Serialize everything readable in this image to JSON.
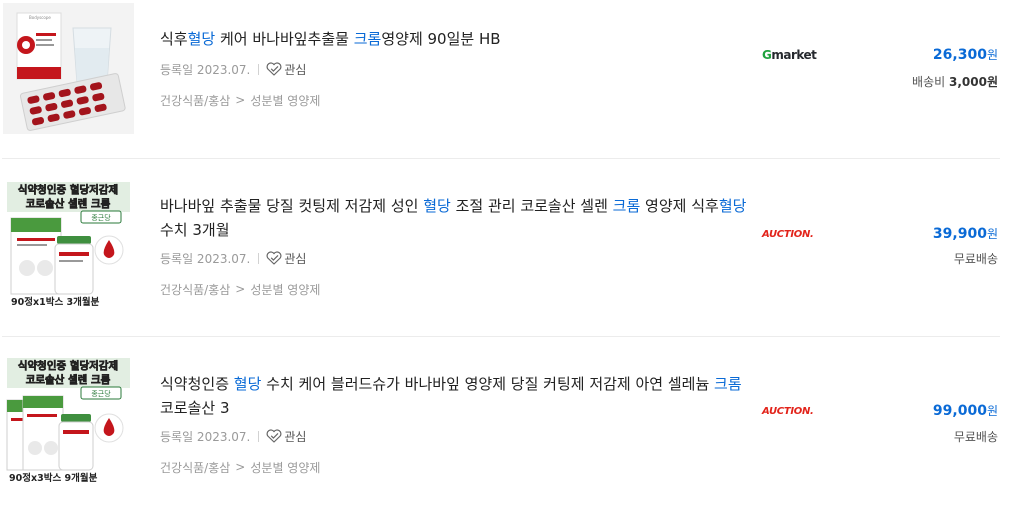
{
  "products": [
    {
      "title_parts": [
        {
          "text": "식후",
          "hl": false
        },
        {
          "text": "혈당",
          "hl": true
        },
        {
          "text": " 케어 바나바잎추출물 ",
          "hl": false
        },
        {
          "text": "크롬",
          "hl": true
        },
        {
          "text": "영양제 90일분 HB",
          "hl": false
        }
      ],
      "reg_date": "등록일 2023.07.",
      "zzim_label": "관심",
      "category": [
        "건강식품/홍삼",
        "성분별 영양제"
      ],
      "mall": "Gmarket",
      "price": "26,300",
      "price_unit": "원",
      "shipping_label": "배송비",
      "shipping_fee": "3,000원",
      "thumb_brand": "Bodyscope"
    },
    {
      "title_parts": [
        {
          "text": "바나바잎 추출물 당질 컷팅제 저감제 성인 ",
          "hl": false
        },
        {
          "text": "혈당",
          "hl": true
        },
        {
          "text": " 조절 관리 코로솔산 셀렌 ",
          "hl": false
        },
        {
          "text": "크롬",
          "hl": true
        },
        {
          "text": " 영양제 식후",
          "hl": false
        },
        {
          "text": "혈당",
          "hl": true
        },
        {
          "text": "수치 3개월",
          "hl": false
        }
      ],
      "reg_date": "등록일 2023.07.",
      "zzim_label": "관심",
      "category": [
        "건강식품/홍삼",
        "성분별 영양제"
      ],
      "mall": "AUCTION.",
      "price": "39,900",
      "price_unit": "원",
      "shipping_label": "무료배송",
      "shipping_fee": "",
      "thumb_top1": "식약청인증 혈당저감제",
      "thumb_top2": "코로솔산 셀렌 크롬",
      "thumb_bottom": "90정x1박스 3개월분",
      "thumb_brand": "종근당"
    },
    {
      "title_parts": [
        {
          "text": "식약청인증 ",
          "hl": false
        },
        {
          "text": "혈당",
          "hl": true
        },
        {
          "text": " 수치 케어 블러드슈가 바나바잎 영양제 당질 커팅제 저감제 아연 셀레늄 ",
          "hl": false
        },
        {
          "text": "크롬",
          "hl": true
        },
        {
          "text": " 코로솔산 3",
          "hl": false
        }
      ],
      "reg_date": "등록일 2023.07.",
      "zzim_label": "관심",
      "category": [
        "건강식품/홍삼",
        "성분별 영양제"
      ],
      "mall": "AUCTION.",
      "price": "99,000",
      "price_unit": "원",
      "shipping_label": "무료배송",
      "shipping_fee": "",
      "thumb_top1": "식약청인증 혈당저감제",
      "thumb_top2": "코로솔산 셀렌 크롬",
      "thumb_bottom": "90정x3박스 9개월분",
      "thumb_brand": "종근당"
    }
  ],
  "colors": {
    "highlight": "#0a6ad6",
    "price": "#0a6ad6",
    "gmarket_green": "#1fa23e",
    "auction_red": "#e2231a",
    "thumb_yellow": "#f5d20a",
    "thumb_red": "#c4161c"
  },
  "icons": [
    "heart-check-icon",
    "chevron-right-icon"
  ]
}
